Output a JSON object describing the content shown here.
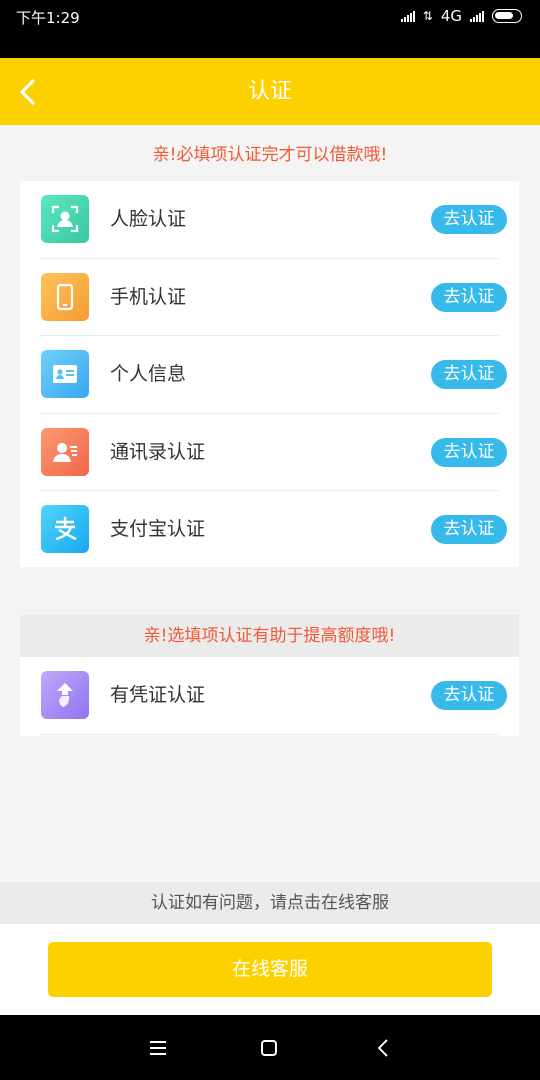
{
  "status": {
    "time": "下午1:29",
    "network": "4G"
  },
  "header": {
    "title": "认证"
  },
  "required": {
    "notice": "亲!必填项认证完才可以借款哦!",
    "items": [
      {
        "label": "人脸认证",
        "button": "去认证",
        "icon": "face-scan-icon",
        "colors": [
          "#5ee6c0",
          "#36c9a2"
        ]
      },
      {
        "label": "手机认证",
        "button": "去认证",
        "icon": "phone-icon",
        "colors": [
          "#fdc45a",
          "#f59b33"
        ]
      },
      {
        "label": "个人信息",
        "button": "去认证",
        "icon": "id-card-icon",
        "colors": [
          "#6ed2fa",
          "#3aa6f0"
        ]
      },
      {
        "label": "通讯录认证",
        "button": "去认证",
        "icon": "contacts-icon",
        "colors": [
          "#fb9a73",
          "#f2664a"
        ]
      },
      {
        "label": "支付宝认证",
        "button": "去认证",
        "icon": "alipay-icon",
        "colors": [
          "#4fd6fb",
          "#1aa6ee"
        ]
      }
    ]
  },
  "optional": {
    "notice": "亲!选填项认证有助于提高额度哦!",
    "items": [
      {
        "label": "有凭证认证",
        "button": "去认证",
        "icon": "voucher-icon",
        "colors": [
          "#c2a8fb",
          "#8e74ee"
        ]
      }
    ]
  },
  "help": {
    "text": "认证如有问题，请点击在线客服"
  },
  "service_button": "在线客服",
  "colors": {
    "primary_yellow": "#fdd100",
    "button_blue": "#37b9ea",
    "notice_red": "#f05a36"
  }
}
